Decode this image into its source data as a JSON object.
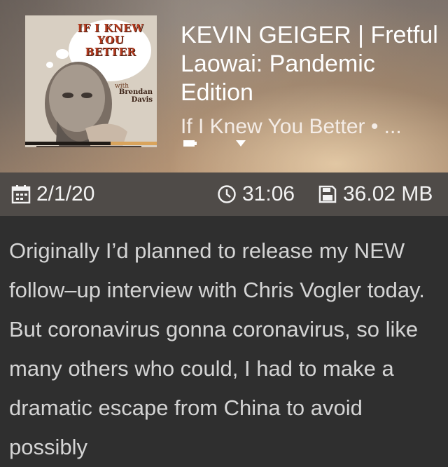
{
  "episode": {
    "title": "KEVIN GEIGER | Fretful Laowai: Pandemic Edition",
    "podcast": "If I Knew You Better • ...",
    "date": "2/1/20",
    "duration": "31:06",
    "size": "36.02 MB",
    "progress": 0.65,
    "description": "Originally I’d planned to release my NEW follow–up interview with Chris Vogler today. But coronavirus gonna coronavirus, so like many others who could, I had to make a dramatic escape from China to avoid possibly"
  },
  "artwork": {
    "title_lines": [
      "IF I KNEW",
      "YOU",
      "BETTER"
    ],
    "with": "with",
    "author": "Brendan Davis"
  },
  "icons": {
    "date": "calendar-icon",
    "duration": "clock-icon",
    "size": "save-disk-icon",
    "mini_left": "device-icon",
    "mini_right": "download-icon"
  },
  "colors": {
    "meta_bar": "#4f4b48",
    "background": "#2f2f2f",
    "description_text": "#d4d4d4"
  }
}
